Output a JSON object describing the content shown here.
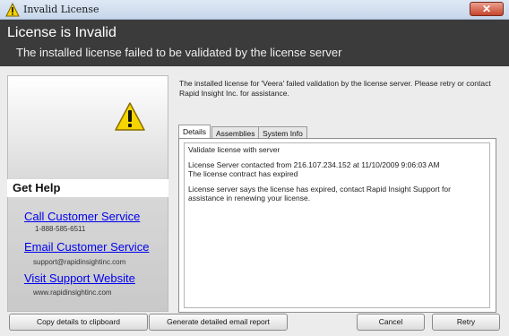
{
  "window": {
    "title": "Invalid License",
    "close_glyph": "✕"
  },
  "header": {
    "title": "License is Invalid",
    "subtitle": "The installed license failed to be validated by the license server"
  },
  "help": {
    "heading": "Get Help",
    "call_label": "Call Customer Service",
    "phone": "1-888-585-6511",
    "email_label": "Email Customer Service",
    "email": "support@rapidinsightinc.com",
    "website_label": "Visit Support Website",
    "website": "www.rapidinsightinc.com"
  },
  "info_text": "The installed license for 'Veera' failed validation by the license server.  Please retry or contact Rapid Insight Inc. for assistance.",
  "tabs": [
    {
      "label": "Details",
      "active": true
    },
    {
      "label": "Assemblies",
      "active": false
    },
    {
      "label": "System Info",
      "active": false
    }
  ],
  "details": [
    "Validate license with server",
    "License Server contacted from 216.107.234.152 at 11/10/2009 9:06:03 AM",
    "The license contract has expired",
    "License server says the license has expired, contact Rapid Insight Support for assistance in renewing your license."
  ],
  "buttons": {
    "copy": "Copy details to clipboard",
    "email_report": "Generate detailed email report",
    "cancel": "Cancel",
    "retry": "Retry"
  },
  "icons": {
    "title": "warning-icon",
    "main": "warning-icon"
  },
  "colors": {
    "header_bg": "#3b3b3b",
    "link": "#0000ee",
    "close": "#c7442b",
    "warning": "#f5d400"
  }
}
